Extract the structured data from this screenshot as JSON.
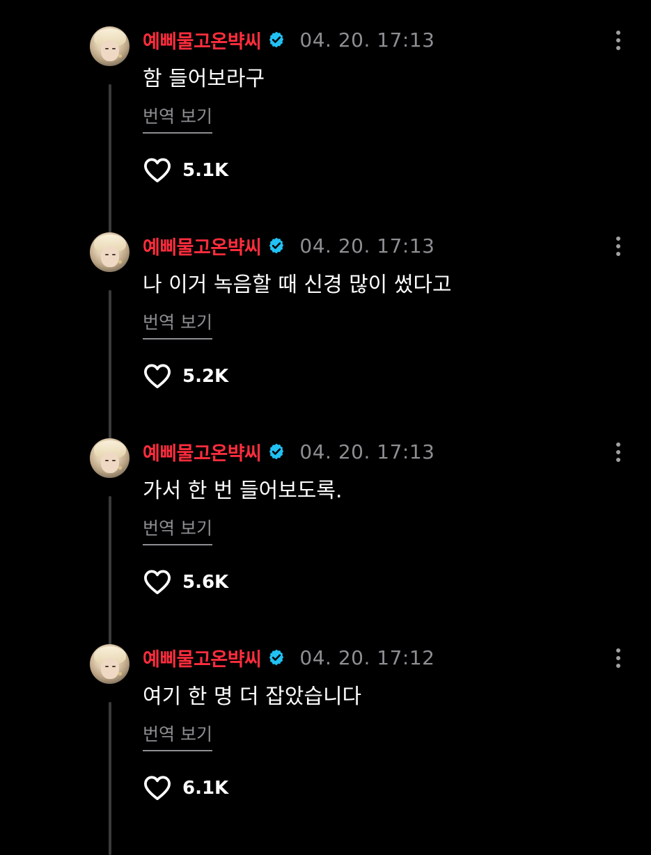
{
  "colors": {
    "background": "#000000",
    "username": "#ff2d3d",
    "verified": "#21c1f3",
    "muted": "#8e8e93",
    "text": "#ffffff"
  },
  "posts": [
    {
      "username": "예삐물고온뱍씨",
      "timestamp": "04. 20. 17:13",
      "text": "함 들어보라구",
      "translate_label": "번역 보기",
      "likes": "5.1K"
    },
    {
      "username": "예삐물고온뱍씨",
      "timestamp": "04. 20. 17:13",
      "text": "나 이거 녹음할 때 신경 많이 썼다고",
      "translate_label": "번역 보기",
      "likes": "5.2K"
    },
    {
      "username": "예삐물고온뱍씨",
      "timestamp": "04. 20. 17:13",
      "text": "가서 한 번 들어보도록.",
      "translate_label": "번역 보기",
      "likes": "5.6K"
    },
    {
      "username": "예삐물고온뱍씨",
      "timestamp": "04. 20. 17:12",
      "text": "여기 한 명 더 잡았습니다",
      "translate_label": "번역 보기",
      "likes": "6.1K"
    }
  ],
  "icons": {
    "avatar": "profile-photo",
    "verified": "verified-badge-icon",
    "more": "more-vertical-icon",
    "like": "heart-outline-icon"
  }
}
